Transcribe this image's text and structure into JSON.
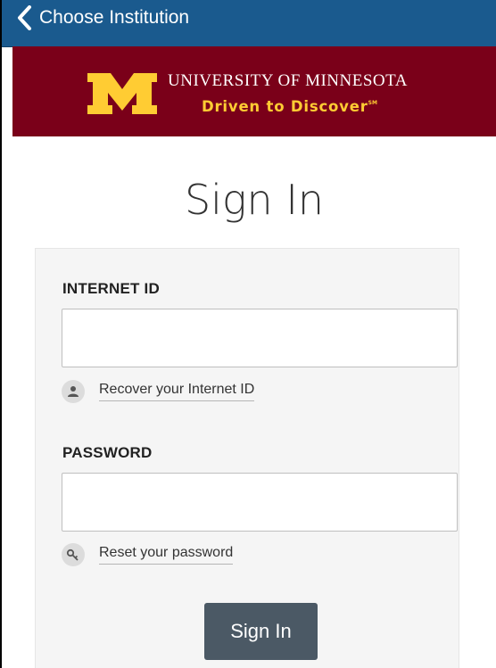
{
  "nav": {
    "back_label": "Choose Institution"
  },
  "header": {
    "university_name": "UNIVERSITY OF MINNESOTA",
    "tagline": "Driven to Discover",
    "tagline_mark": "SM",
    "logo": "block-M-logo",
    "colors": {
      "maroon": "#7a0019",
      "gold": "#ffcc33",
      "nav_blue": "#1a5a8e"
    }
  },
  "page": {
    "title": "Sign In"
  },
  "form": {
    "internet_id": {
      "label": "INTERNET ID",
      "value": "",
      "help_icon": "user-icon",
      "help_link": "Recover your Internet ID"
    },
    "password": {
      "label": "PASSWORD",
      "value": "",
      "help_icon": "key-icon",
      "help_link": "Reset your password"
    },
    "submit_label": "Sign In",
    "submit_color": "#4b5965"
  }
}
